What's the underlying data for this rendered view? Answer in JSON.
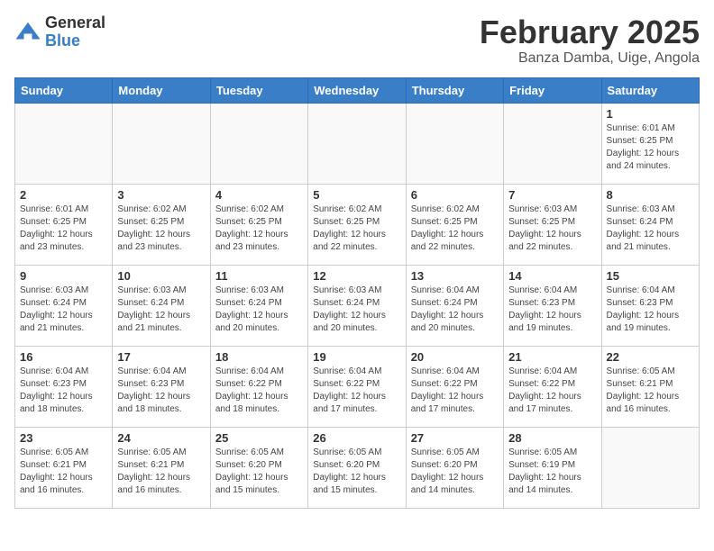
{
  "logo": {
    "general": "General",
    "blue": "Blue"
  },
  "title": "February 2025",
  "location": "Banza Damba, Uige, Angola",
  "days_of_week": [
    "Sunday",
    "Monday",
    "Tuesday",
    "Wednesday",
    "Thursday",
    "Friday",
    "Saturday"
  ],
  "weeks": [
    [
      {
        "day": "",
        "info": ""
      },
      {
        "day": "",
        "info": ""
      },
      {
        "day": "",
        "info": ""
      },
      {
        "day": "",
        "info": ""
      },
      {
        "day": "",
        "info": ""
      },
      {
        "day": "",
        "info": ""
      },
      {
        "day": "1",
        "info": "Sunrise: 6:01 AM\nSunset: 6:25 PM\nDaylight: 12 hours\nand 24 minutes."
      }
    ],
    [
      {
        "day": "2",
        "info": "Sunrise: 6:01 AM\nSunset: 6:25 PM\nDaylight: 12 hours\nand 23 minutes."
      },
      {
        "day": "3",
        "info": "Sunrise: 6:02 AM\nSunset: 6:25 PM\nDaylight: 12 hours\nand 23 minutes."
      },
      {
        "day": "4",
        "info": "Sunrise: 6:02 AM\nSunset: 6:25 PM\nDaylight: 12 hours\nand 23 minutes."
      },
      {
        "day": "5",
        "info": "Sunrise: 6:02 AM\nSunset: 6:25 PM\nDaylight: 12 hours\nand 22 minutes."
      },
      {
        "day": "6",
        "info": "Sunrise: 6:02 AM\nSunset: 6:25 PM\nDaylight: 12 hours\nand 22 minutes."
      },
      {
        "day": "7",
        "info": "Sunrise: 6:03 AM\nSunset: 6:25 PM\nDaylight: 12 hours\nand 22 minutes."
      },
      {
        "day": "8",
        "info": "Sunrise: 6:03 AM\nSunset: 6:24 PM\nDaylight: 12 hours\nand 21 minutes."
      }
    ],
    [
      {
        "day": "9",
        "info": "Sunrise: 6:03 AM\nSunset: 6:24 PM\nDaylight: 12 hours\nand 21 minutes."
      },
      {
        "day": "10",
        "info": "Sunrise: 6:03 AM\nSunset: 6:24 PM\nDaylight: 12 hours\nand 21 minutes."
      },
      {
        "day": "11",
        "info": "Sunrise: 6:03 AM\nSunset: 6:24 PM\nDaylight: 12 hours\nand 20 minutes."
      },
      {
        "day": "12",
        "info": "Sunrise: 6:03 AM\nSunset: 6:24 PM\nDaylight: 12 hours\nand 20 minutes."
      },
      {
        "day": "13",
        "info": "Sunrise: 6:04 AM\nSunset: 6:24 PM\nDaylight: 12 hours\nand 20 minutes."
      },
      {
        "day": "14",
        "info": "Sunrise: 6:04 AM\nSunset: 6:23 PM\nDaylight: 12 hours\nand 19 minutes."
      },
      {
        "day": "15",
        "info": "Sunrise: 6:04 AM\nSunset: 6:23 PM\nDaylight: 12 hours\nand 19 minutes."
      }
    ],
    [
      {
        "day": "16",
        "info": "Sunrise: 6:04 AM\nSunset: 6:23 PM\nDaylight: 12 hours\nand 18 minutes."
      },
      {
        "day": "17",
        "info": "Sunrise: 6:04 AM\nSunset: 6:23 PM\nDaylight: 12 hours\nand 18 minutes."
      },
      {
        "day": "18",
        "info": "Sunrise: 6:04 AM\nSunset: 6:22 PM\nDaylight: 12 hours\nand 18 minutes."
      },
      {
        "day": "19",
        "info": "Sunrise: 6:04 AM\nSunset: 6:22 PM\nDaylight: 12 hours\nand 17 minutes."
      },
      {
        "day": "20",
        "info": "Sunrise: 6:04 AM\nSunset: 6:22 PM\nDaylight: 12 hours\nand 17 minutes."
      },
      {
        "day": "21",
        "info": "Sunrise: 6:04 AM\nSunset: 6:22 PM\nDaylight: 12 hours\nand 17 minutes."
      },
      {
        "day": "22",
        "info": "Sunrise: 6:05 AM\nSunset: 6:21 PM\nDaylight: 12 hours\nand 16 minutes."
      }
    ],
    [
      {
        "day": "23",
        "info": "Sunrise: 6:05 AM\nSunset: 6:21 PM\nDaylight: 12 hours\nand 16 minutes."
      },
      {
        "day": "24",
        "info": "Sunrise: 6:05 AM\nSunset: 6:21 PM\nDaylight: 12 hours\nand 16 minutes."
      },
      {
        "day": "25",
        "info": "Sunrise: 6:05 AM\nSunset: 6:20 PM\nDaylight: 12 hours\nand 15 minutes."
      },
      {
        "day": "26",
        "info": "Sunrise: 6:05 AM\nSunset: 6:20 PM\nDaylight: 12 hours\nand 15 minutes."
      },
      {
        "day": "27",
        "info": "Sunrise: 6:05 AM\nSunset: 6:20 PM\nDaylight: 12 hours\nand 14 minutes."
      },
      {
        "day": "28",
        "info": "Sunrise: 6:05 AM\nSunset: 6:19 PM\nDaylight: 12 hours\nand 14 minutes."
      },
      {
        "day": "",
        "info": ""
      }
    ]
  ]
}
